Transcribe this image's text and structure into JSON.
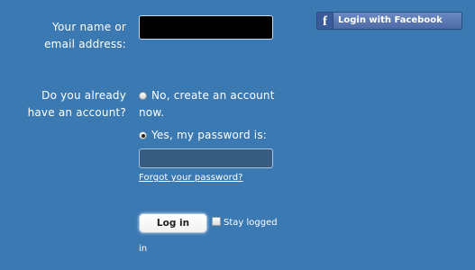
{
  "form": {
    "name_label": "Your name or email address:",
    "name_value": "",
    "account_label": "Do you already have an account?",
    "radio_no": "No, create an account now.",
    "radio_yes": "Yes, my password is:",
    "password_value": "",
    "forgot_link": "Forgot your password?",
    "login_button": "Log in",
    "stay_logged_part1": "Stay logged",
    "stay_logged_part2": "in",
    "selected_option": "yes",
    "stay_logged_checked": false
  },
  "facebook": {
    "icon_glyph": "f",
    "label": "Login with Facebook"
  },
  "colors": {
    "background": "#3b79b3",
    "facebook_blue": "#5872ad"
  }
}
